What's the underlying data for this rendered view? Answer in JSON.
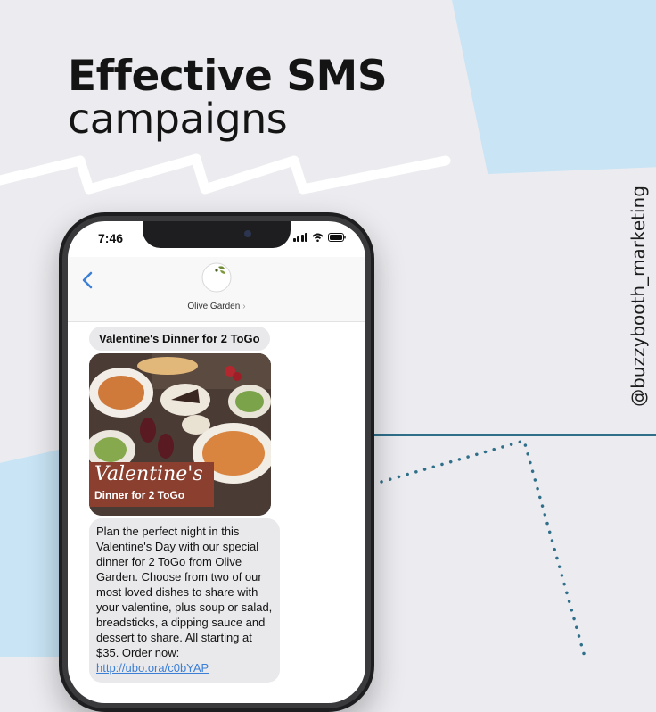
{
  "headline": {
    "line1": "Effective SMS",
    "line2": "campaigns"
  },
  "handle": "@buzzybooth_marketing",
  "colors": {
    "accent_blue": "#c8e4f5",
    "line": "#2f6f8a",
    "imessage_blue": "#3b7fd6",
    "bubble_gray": "#e9e9eb"
  },
  "phone": {
    "status": {
      "time": "7:46",
      "icons": [
        "signal-icon",
        "wifi-icon",
        "battery-icon"
      ]
    },
    "conversation": {
      "back_icon": "chevron-left-icon",
      "logo_text": "Olive Garden",
      "contact_name": "Olive Garden",
      "contact_chevron": "›",
      "messages": {
        "title": "Valentine's Dinner for 2 ToGo",
        "image": {
          "banner_line1": "Valentine's",
          "banner_line2": "Dinner for 2 ToGo"
        },
        "body": "Plan the perfect night in this Valentine's Day with our special dinner for 2 ToGo from Olive Garden. Choose from two of our most loved dishes to share with your valentine, plus soup or salad, breadsticks, a dipping sauce and dessert to share. All starting at $35. Order now:",
        "link": "http://ubo.ora/c0bYAP"
      }
    }
  }
}
